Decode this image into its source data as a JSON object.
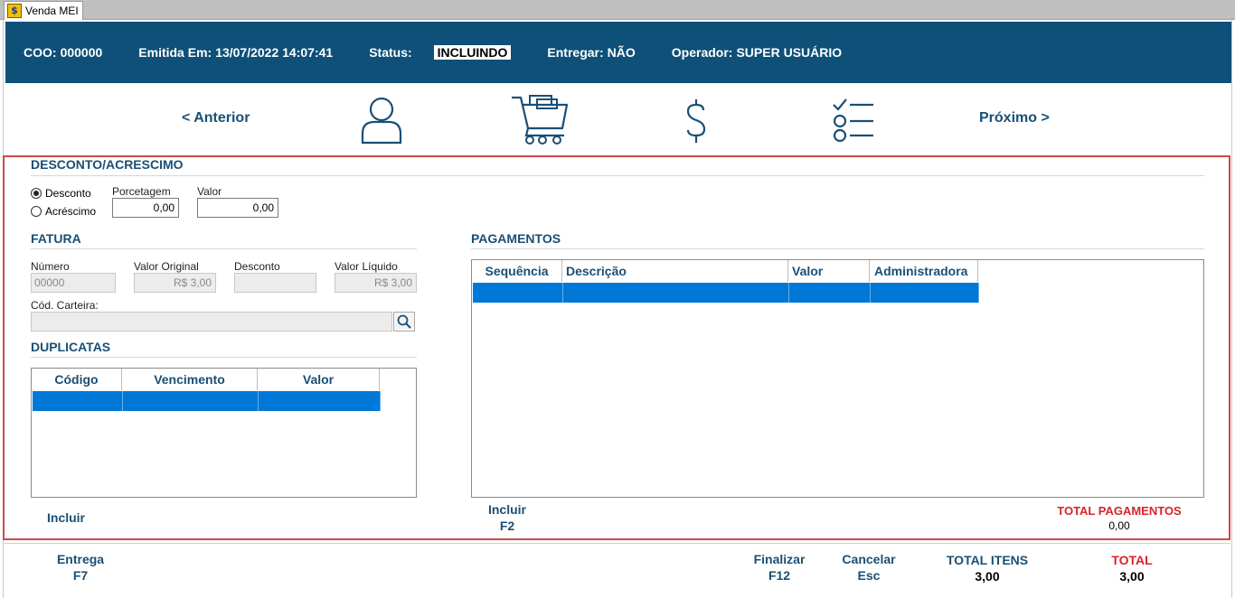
{
  "window": {
    "tab_title": "Venda MEI"
  },
  "header": {
    "coo_label": "COO:",
    "coo_value": "000000",
    "emitida_label": "Emitida Em:",
    "emitida_value": "13/07/2022 14:07:41",
    "status_label": "Status:",
    "status_value": "INCLUINDO",
    "entregar_label": "Entregar:",
    "entregar_value": "NÃO",
    "operador_label": "Operador:",
    "operador_value": "SUPER USUÁRIO"
  },
  "nav": {
    "prev": "< Anterior",
    "next": "Próximo >",
    "steps": [
      "user-icon",
      "cart-icon",
      "dollar-icon",
      "checklist-icon"
    ]
  },
  "desconto": {
    "title": "DESCONTO/ACRESCIMO",
    "option_desconto": "Desconto",
    "option_acrescimo": "Acréscimo",
    "selected": "Desconto",
    "porcentagem_label": "Porcetagem",
    "porcentagem_value": "0,00",
    "valor_label": "Valor",
    "valor_value": "0,00"
  },
  "fatura": {
    "title": "FATURA",
    "numero_label": "Número",
    "numero_value": "00000",
    "valor_original_label": "Valor Original",
    "valor_original_value": "R$ 3,00",
    "desconto_label": "Desconto",
    "desconto_value": "",
    "valor_liquido_label": "Valor Líquido",
    "valor_liquido_value": "R$ 3,00",
    "carteira_label": "Cód. Carteira:",
    "carteira_value": ""
  },
  "duplicatas": {
    "title": "DUPLICATAS",
    "columns": [
      "Código",
      "Vencimento",
      "Valor"
    ],
    "incluir": "Incluir"
  },
  "pagamentos": {
    "title": "PAGAMENTOS",
    "columns": [
      "Sequência",
      "Descrição",
      "Valor",
      "Administradora"
    ],
    "incluir": "Incluir",
    "incluir_key": "F2",
    "total_label": "TOTAL PAGAMENTOS",
    "total_value": "0,00"
  },
  "footer": {
    "entrega_label": "Entrega",
    "entrega_key": "F7",
    "finalizar_label": "Finalizar",
    "finalizar_key": "F12",
    "cancelar_label": "Cancelar",
    "cancelar_key": "Esc",
    "total_itens_label": "TOTAL ITENS",
    "total_itens_value": "3,00",
    "total_label": "TOTAL",
    "total_value": "3,00"
  },
  "colors": {
    "header_bg": "#0f5078",
    "accent_text": "#1a4f75",
    "selection": "#0078d7",
    "total_red": "#d8232a",
    "content_border": "#d0484a"
  }
}
